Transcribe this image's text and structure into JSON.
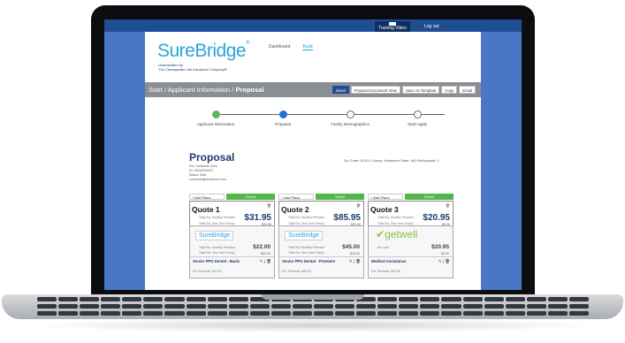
{
  "topbar": {
    "training_video": "Training Video",
    "logout": "Log out"
  },
  "brand": {
    "logo": "SureBridge",
    "reg": "®",
    "tagline_line1": "Underwritten by",
    "tagline_line2": "The Chesapeake Life Insurance Company®"
  },
  "nav": {
    "items": [
      "Dashboard",
      "Build"
    ]
  },
  "breadcrumb": {
    "start": "Start",
    "applicant": "Applicant Information",
    "current": "Proposal",
    "sep": "/"
  },
  "toolbar": {
    "detail": "Detail",
    "document_view": "Proposal Document View",
    "save_template": "Save As Template",
    "copy": "Copy",
    "email": "Email"
  },
  "steps": [
    {
      "label": "Applicant Information",
      "status": "done"
    },
    {
      "label": "Proposal",
      "status": "current"
    },
    {
      "label": "Family Demographics",
      "status": "todo"
    },
    {
      "label": "Start Apply",
      "status": "todo"
    }
  ],
  "proposal": {
    "title": "Proposal",
    "meta": [
      "For: Customer John",
      "ID: 20040243017",
      "Status: New",
      "customer@emailhost.com"
    ],
    "info": "Zip Code: 01001  County: Hampden  State: MA  Participants: 1"
  },
  "quotes": [
    {
      "name": "Quote 1",
      "add": "+ Add Plans",
      "select": "Select",
      "prem_label": "Total Est. Monthly Premium",
      "premium": "$31.95",
      "fee_label": "Total Est. One-Time Fee(s)",
      "fee": "$20.00"
    },
    {
      "name": "Quote 2",
      "add": "+ Add Plans",
      "select": "Select",
      "prem_label": "Total Est. Monthly Premium",
      "premium": "$85.95",
      "fee_label": "Total Est. One-Time Fee(s)",
      "fee": "$20.00"
    },
    {
      "name": "Quote 3",
      "add": "+ Add Plans",
      "select": "Select",
      "prem_label": "Total Est. Monthly Premium",
      "premium": "$20.95",
      "fee_label": "Total Est. One-Time Fee(s)",
      "fee": "$0.00"
    }
  ],
  "plans": [
    {
      "logo": "SureBridge",
      "prem_label": "Total Est. Monthly Premium",
      "premium": "$22.00",
      "fee_label": "Total Est. One-Time Fee(s)",
      "fee": "$20.00",
      "name": "Senior PPO Dental - Basic",
      "sub": "Est. Premium: $22.00"
    },
    {
      "logo": "SureBridge",
      "prem_label": "Total Est. Monthly Premium",
      "premium": "$45.00",
      "fee_label": "Total Est. One-Time Fee(s)",
      "fee": "$20.00",
      "name": "Senior PPO Dental - Premiere",
      "sub": "Est. Premium: $45.00"
    },
    {
      "logo": "getwell",
      "prem_label": "est. cost",
      "premium": "$20.95",
      "fee_label": "",
      "fee": "$0.00",
      "name": "Medical Assistance",
      "sub": "Est. Premium: $20.95"
    }
  ],
  "colors": {
    "brand": "#29a6d6",
    "navy": "#1d3a70",
    "select": "#4fb848",
    "screen_bg": "#4a77c4"
  }
}
